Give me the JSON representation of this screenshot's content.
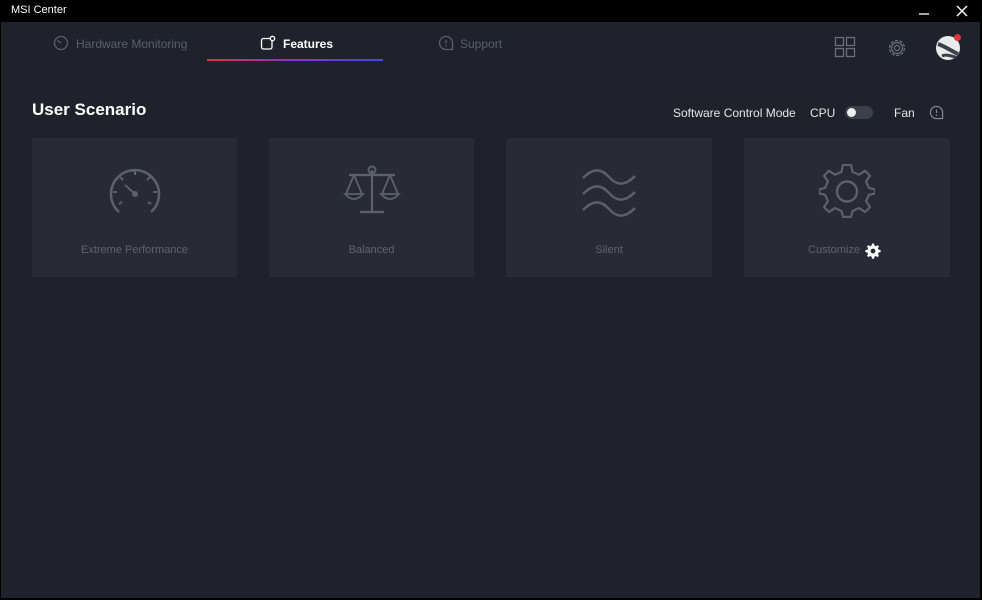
{
  "window": {
    "title": "MSI Center"
  },
  "tabs": [
    {
      "label": "Hardware Monitoring",
      "icon": "gauge-icon",
      "active": false
    },
    {
      "label": "Features",
      "icon": "features-icon",
      "active": true
    },
    {
      "label": "Support",
      "icon": "chat-icon",
      "active": false
    }
  ],
  "header_icons": [
    "apps-grid-icon",
    "settings-gear-icon",
    "avatar-icon"
  ],
  "section": {
    "title": "User Scenario",
    "mode_label": "Software Control Mode",
    "cpu_label": "CPU",
    "fan_label": "Fan",
    "toggle_on": false
  },
  "scenarios": [
    {
      "label": "Extreme Performance",
      "icon": "speedometer-icon"
    },
    {
      "label": "Balanced",
      "icon": "scale-icon"
    },
    {
      "label": "Silent",
      "icon": "waves-icon"
    },
    {
      "label": "Customize",
      "icon": "gear-icon"
    }
  ],
  "colors": {
    "background": "#1f222b",
    "card": "#282b35",
    "accent_start": "#d9363e",
    "accent_end": "#3a4fe0",
    "notification": "#e5323b"
  }
}
